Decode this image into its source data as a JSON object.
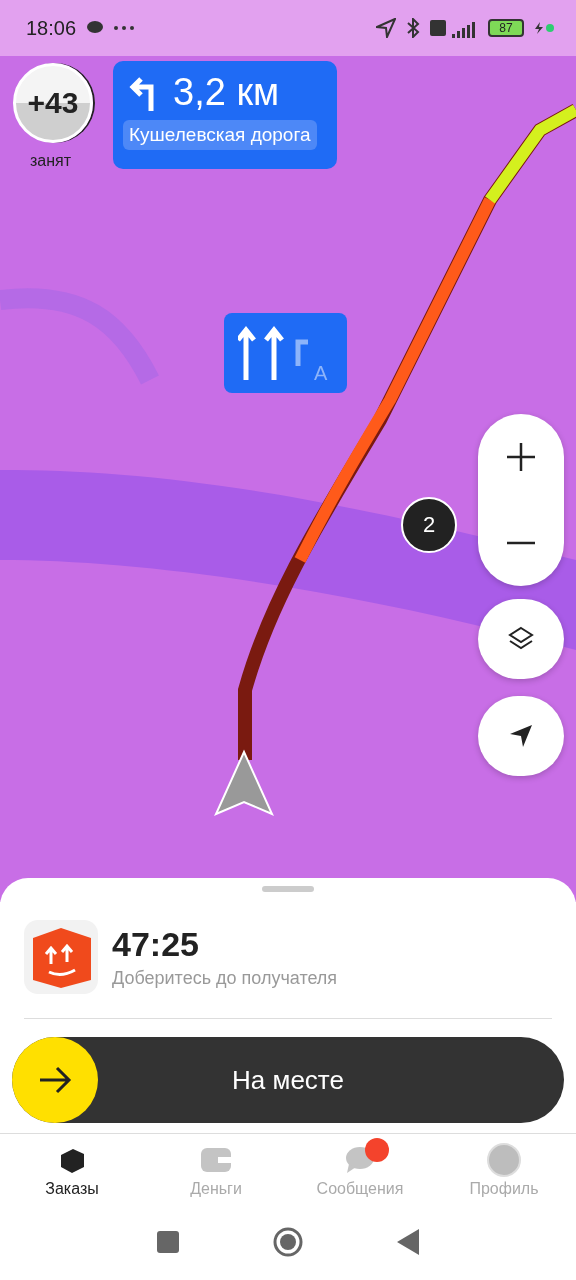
{
  "status_bar": {
    "time": "18:06",
    "battery": "87"
  },
  "speed_badge": {
    "value": "+43",
    "caption": "занят"
  },
  "maneuver": {
    "distance": "3,2 км",
    "street": "Кушелевская дорога"
  },
  "lane_hint": {
    "letter": "A"
  },
  "cluster_marker": {
    "count": "2"
  },
  "sheet": {
    "timer": "47:25",
    "subtitle": "Доберитесь до получателя",
    "action": "На месте",
    "level": 0
  },
  "tabs": [
    {
      "label": "Заказы",
      "kind": "box",
      "selected": true,
      "badge": false
    },
    {
      "label": "Деньги",
      "kind": "wallet",
      "selected": false,
      "badge": false
    },
    {
      "label": "Сообщения",
      "kind": "chat",
      "selected": false,
      "badge": true
    },
    {
      "label": "Профиль",
      "kind": "avatar",
      "selected": false,
      "badge": false
    }
  ]
}
